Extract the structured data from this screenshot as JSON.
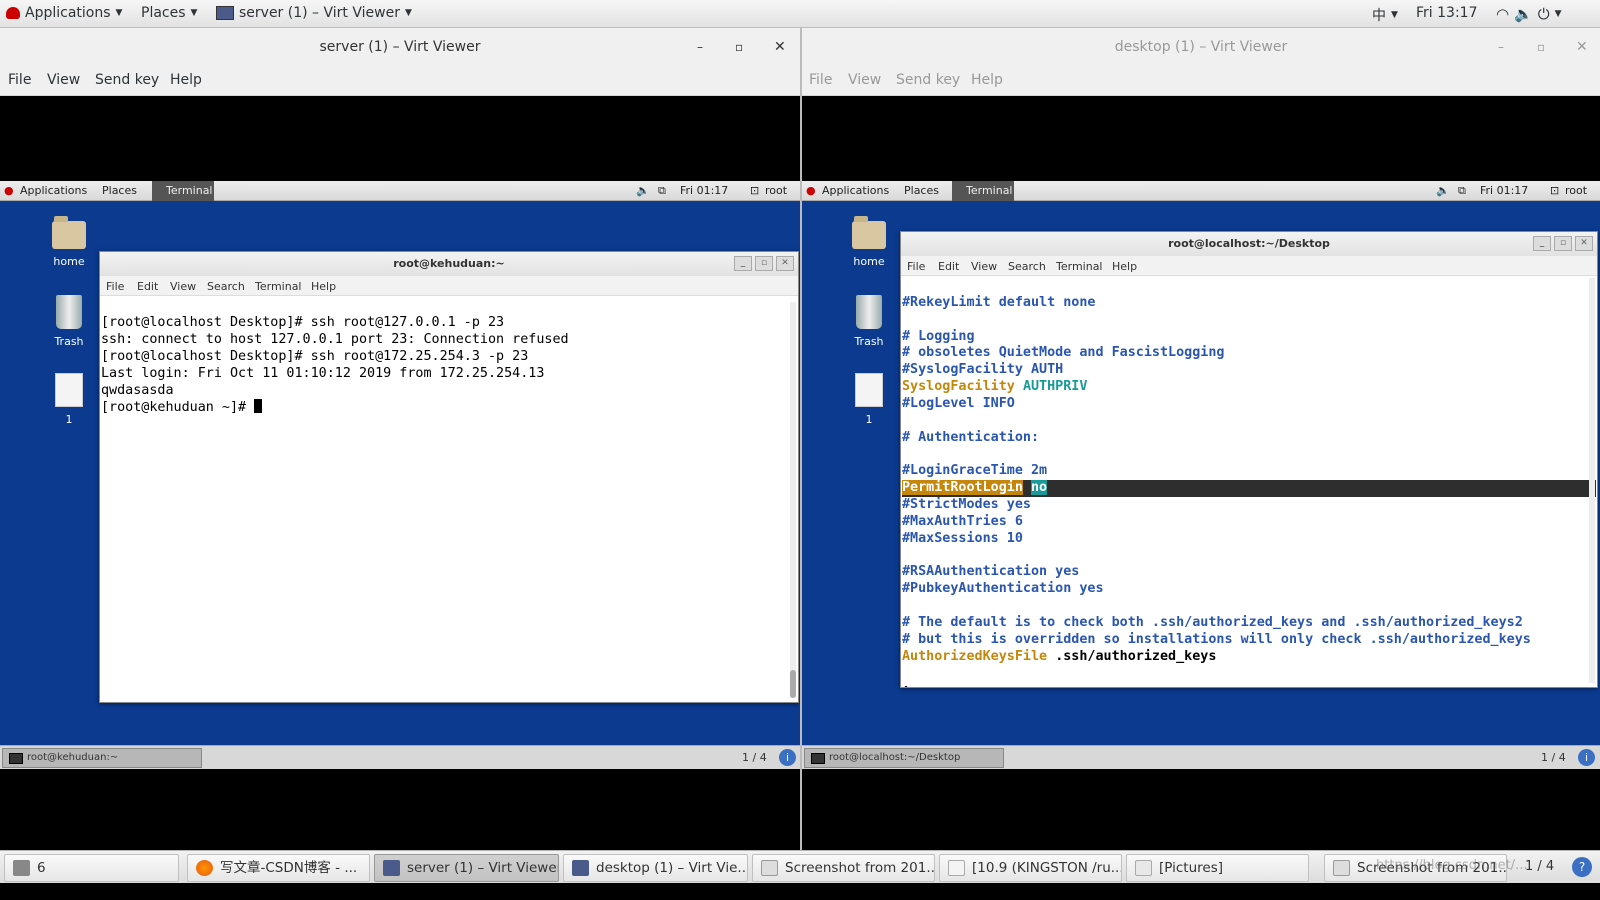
{
  "host_topbar": {
    "applications": "Applications",
    "places": "Places",
    "active_window": "server (1) – Virt Viewer",
    "input_method": "中",
    "clock": "Fri 13:17"
  },
  "server_window": {
    "title": "server (1) – Virt Viewer",
    "menu": [
      "File",
      "View",
      "Send key",
      "Help"
    ],
    "guest": {
      "topbar": {
        "applications": "Applications",
        "places": "Places",
        "terminal": "Terminal",
        "clock": "Fri 01:17",
        "user": "root"
      },
      "desktop_icons": [
        "home",
        "Trash",
        "1"
      ],
      "terminal": {
        "title": "root@kehuduan:~",
        "menu": [
          "File",
          "Edit",
          "View",
          "Search",
          "Terminal",
          "Help"
        ],
        "lines": [
          "[root@localhost Desktop]# ssh root@127.0.0.1 -p 23",
          "ssh: connect to host 127.0.0.1 port 23: Connection refused",
          "[root@localhost Desktop]# ssh root@172.25.254.3 -p 23",
          "Last login: Fri Oct 11 01:10:12 2019 from 172.25.254.13",
          "qwdasasda",
          "[root@kehuduan ~]# "
        ]
      },
      "taskbar": {
        "task": "root@kehuduan:~",
        "workspace": "1 / 4"
      }
    }
  },
  "desktop_window": {
    "title": "desktop (1) – Virt Viewer",
    "menu": [
      "File",
      "View",
      "Send key",
      "Help"
    ],
    "guest": {
      "topbar": {
        "applications": "Applications",
        "places": "Places",
        "terminal": "Terminal",
        "clock": "Fri 01:17",
        "user": "root"
      },
      "desktop_icons": [
        "home",
        "Trash",
        "1"
      ],
      "terminal": {
        "title": "root@localhost:~/Desktop",
        "menu": [
          "File",
          "Edit",
          "View",
          "Search",
          "Terminal",
          "Help"
        ],
        "config": {
          "l1": "#RekeyLimit default none",
          "l3": "# Logging",
          "l4": "# obsoletes QuietMode and FascistLogging",
          "l5": "#SyslogFacility AUTH",
          "l6k": "SyslogFacility",
          "l6v": "AUTHPRIV",
          "l7": "#LogLevel INFO",
          "l9": "# Authentication:",
          "l11": "#LoginGraceTime 2m",
          "l12k": "PermitRootLogin",
          "l12v": "no",
          "l13": "#StrictModes yes",
          "l14": "#MaxAuthTries 6",
          "l15": "#MaxSessions 10",
          "l17": "#RSAAuthentication yes",
          "l18": "#PubkeyAuthentication yes",
          "l20": "# The default is to check both .ssh/authorized_keys and .ssh/authorized_keys2",
          "l21": "# but this is overridden so installations will only check .ssh/authorized_keys",
          "l22k": "AuthorizedKeysFile",
          "l22v": ".ssh/authorized_keys",
          "prompt": ":"
        }
      },
      "taskbar": {
        "task": "root@localhost:~/Desktop",
        "workspace": "1 / 4"
      }
    }
  },
  "host_taskbar": {
    "workspace_count": "6",
    "items": [
      "写文章-CSDN博客 - ...",
      "server (1) – Virt Viewer",
      "desktop (1) – Virt Vie...",
      "Screenshot from 201...",
      "[10.9 (KINGSTON /ru...",
      "[Pictures]",
      "Screenshot from 201..."
    ],
    "workspace": "1 / 4",
    "watermark": "https://blog.csdn.net/..."
  }
}
